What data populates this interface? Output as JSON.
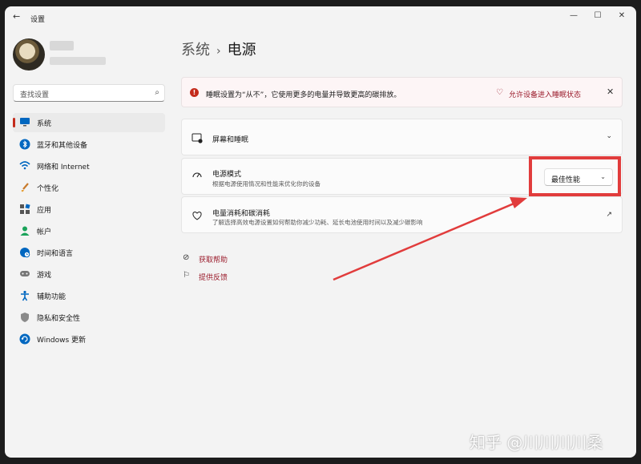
{
  "window": {
    "title": "设置",
    "back": "←",
    "minimize": "—",
    "maximize": "☐",
    "close": "✕"
  },
  "search": {
    "placeholder": "查找设置",
    "icon": "search-icon"
  },
  "sidebar": {
    "items": [
      {
        "label": "系统",
        "icon": "monitor-icon",
        "active": true
      },
      {
        "label": "蓝牙和其他设备",
        "icon": "bluetooth-icon"
      },
      {
        "label": "网络和 Internet",
        "icon": "wifi-icon"
      },
      {
        "label": "个性化",
        "icon": "brush-icon"
      },
      {
        "label": "应用",
        "icon": "apps-icon"
      },
      {
        "label": "帐户",
        "icon": "person-icon"
      },
      {
        "label": "时间和语言",
        "icon": "globe-clock-icon"
      },
      {
        "label": "游戏",
        "icon": "gamepad-icon"
      },
      {
        "label": "辅助功能",
        "icon": "accessibility-icon"
      },
      {
        "label": "隐私和安全性",
        "icon": "shield-icon"
      },
      {
        "label": "Windows 更新",
        "icon": "update-icon"
      }
    ]
  },
  "breadcrumb": {
    "parent": "系统",
    "separator": "›",
    "current": "电源"
  },
  "banner": {
    "text": "睡眠设置为“从不”，它使用更多的电量并导致更高的碳排放。",
    "action": "允许设备进入睡眠状态",
    "close": "✕"
  },
  "cards": {
    "screen_sleep": {
      "title": "屏幕和睡眠",
      "chevron": "⌄"
    },
    "power_mode": {
      "title": "电源模式",
      "subtitle": "根据电源使用情况和性能来优化你的设备",
      "value": "最佳性能",
      "chevron": "⌄"
    },
    "energy": {
      "title": "电量消耗和碳消耗",
      "subtitle": "了解选择高效电源设置如何帮助你减少功耗、延长电池使用时间以及减少碳影响",
      "external": "↗"
    }
  },
  "links": {
    "help": "获取帮助",
    "feedback": "提供反馈"
  },
  "watermark": "知乎 @川川川川桑",
  "colors": {
    "accent": "#c42b1c",
    "link": "#9b1c2c",
    "annotation": "#e13c3c"
  }
}
